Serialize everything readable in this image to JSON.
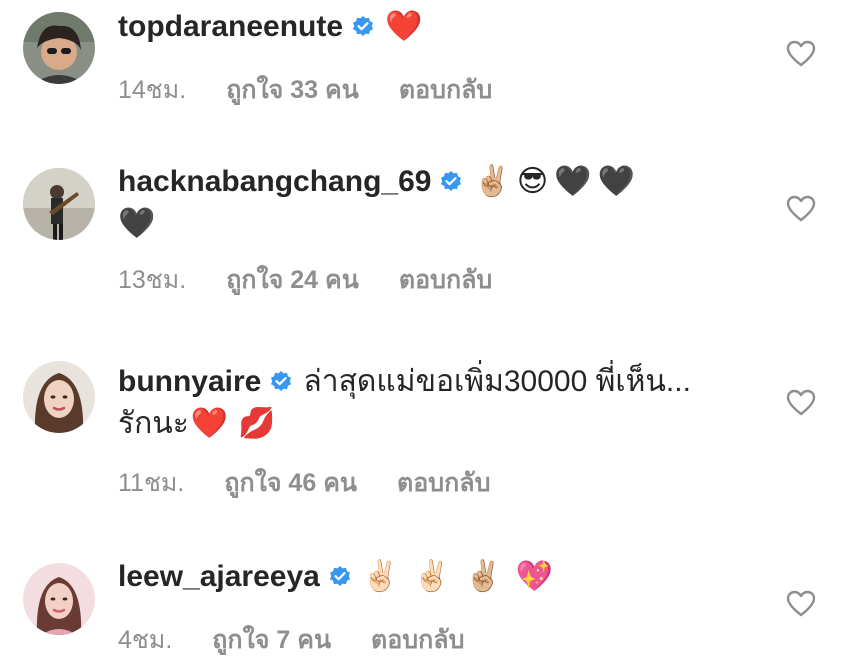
{
  "comments": [
    {
      "username": "topdaraneenute",
      "text_line1": "",
      "emojis_line1": [
        "❤️"
      ],
      "text_line2": "",
      "emojis_line2": [],
      "time": "14ชม.",
      "likes": "ถูกใจ 33 คน",
      "reply": "ตอบกลับ",
      "avatar_icon": "profile-photo-woman-sunglasses"
    },
    {
      "username": "hacknabangchang_69",
      "text_line1": "",
      "emojis_line1": [
        "✌🏼",
        "😎",
        "🖤",
        "🖤"
      ],
      "text_line2": "",
      "emojis_line2": [
        "🖤"
      ],
      "time": "13ชม.",
      "likes": "ถูกใจ 24 คน",
      "reply": "ตอบกลับ",
      "avatar_icon": "profile-photo-man-guitar"
    },
    {
      "username": "bunnyaire",
      "text_line1": "ล่าสุดแม่ขอเพิ่ม30000 พี่เห็น...",
      "emojis_line1": [],
      "text_line2": "รักนะ",
      "emojis_line2": [
        "❤️",
        "💋"
      ],
      "time": "11ชม.",
      "likes": "ถูกใจ 46 คน",
      "reply": "ตอบกลับ",
      "avatar_icon": "profile-photo-woman-portrait"
    },
    {
      "username": "leew_ajareeya",
      "text_line1": "",
      "emojis_line1": [
        "✌🏻",
        "✌🏻",
        "✌🏼",
        "💖"
      ],
      "text_line2": "",
      "emojis_line2": [],
      "time": "4ชม.",
      "likes": "ถูกใจ 7 คน",
      "reply": "ตอบกลับ",
      "avatar_icon": "profile-photo-woman-pink"
    }
  ],
  "icons": {
    "verified": "verified-badge-icon",
    "like": "heart-outline-icon"
  },
  "colors": {
    "verified": "#3897f0",
    "meta_text": "#8e8e8e",
    "username": "#262626",
    "heart_outline": "#8e8e8e"
  }
}
